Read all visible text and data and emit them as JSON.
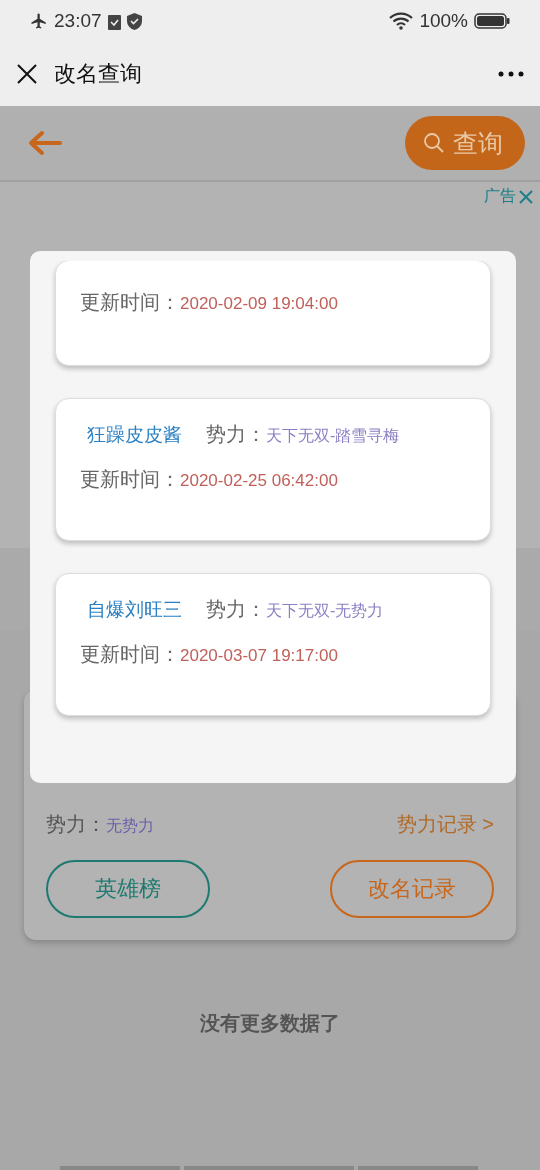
{
  "status_bar": {
    "time": "23:07",
    "battery": "100%"
  },
  "nav_bar": {
    "title": "改名查询"
  },
  "header": {
    "search_button": "查询"
  },
  "ad": {
    "label": "广告"
  },
  "profile_card": {
    "faction_label": "势力：",
    "faction": "无势力",
    "faction_link": "势力记录 >",
    "buttons": [
      {
        "label": "英雄榜",
        "color": "#1e7a70"
      },
      {
        "label": "改名记录",
        "color": "#c8661c"
      }
    ]
  },
  "footer_text": "没有更多数据了",
  "dialog": {
    "records": [
      {
        "update_label": "更新时间：",
        "updated": "2020-02-09 19:04:00"
      },
      {
        "name": "狂躁皮皮酱",
        "faction_label": "势力：",
        "faction": "天下无双-踏雪寻梅",
        "update_label": "更新时间：",
        "updated": "2020-02-25 06:42:00"
      },
      {
        "name": "自爆刘旺三",
        "faction_label": "势力：",
        "faction": "天下无双-无势力",
        "update_label": "更新时间：",
        "updated": "2020-03-07 19:17:00"
      }
    ]
  }
}
